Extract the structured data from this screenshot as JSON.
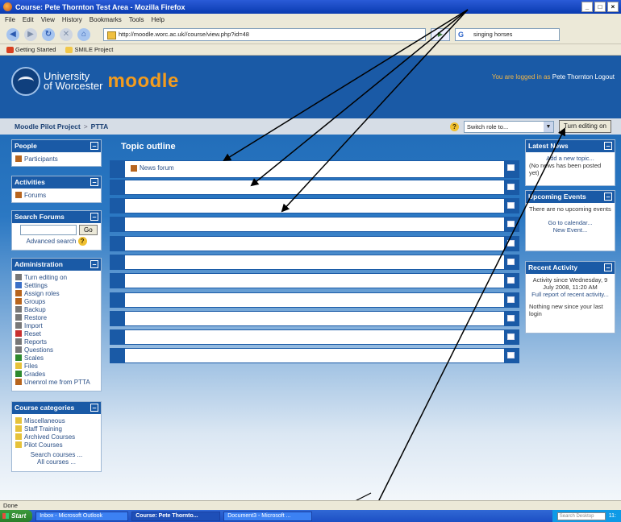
{
  "window": {
    "title": "Course: Pete Thornton Test Area - Mozilla Firefox",
    "controls": [
      "_",
      "□",
      "×"
    ]
  },
  "menubar": [
    "File",
    "Edit",
    "View",
    "History",
    "Bookmarks",
    "Tools",
    "Help"
  ],
  "navbar": {
    "url": "http://moodle.worc.ac.uk//course/view.php?id=48",
    "search_value": "singing horses"
  },
  "bookmarks": [
    "Getting Started",
    "SMILE Project"
  ],
  "header": {
    "logo_line1": "University",
    "logo_line2": "of Worcester",
    "brand": "moodle",
    "logged_in_prefix": "You are logged in as",
    "user_name": "Pete Thornton",
    "logout": "Logout"
  },
  "breadcrumb": {
    "root": "Moodle Pilot Project",
    "separator": ">",
    "current": "PTTA"
  },
  "role_switch": {
    "selected": "Switch role to...",
    "edit_button": "Turn editing on"
  },
  "blocks_left": {
    "people": {
      "title": "People",
      "items": [
        "Participants"
      ]
    },
    "activities": {
      "title": "Activities",
      "items": [
        "Forums"
      ]
    },
    "search_forums": {
      "title": "Search Forums",
      "go": "Go",
      "advanced": "Advanced search"
    },
    "administration": {
      "title": "Administration",
      "items": [
        "Turn editing on",
        "Settings",
        "Assign roles",
        "Groups",
        "Backup",
        "Restore",
        "Import",
        "Reset",
        "Reports",
        "Questions",
        "Scales",
        "Files",
        "Grades",
        "Unenrol me from PTTA"
      ]
    },
    "course_categories": {
      "title": "Course categories",
      "items": [
        "Miscellaneous",
        "Staff Training",
        "Archived Courses",
        "Pilot Courses"
      ],
      "search": "Search courses ...",
      "all": "All courses ..."
    }
  },
  "topic_outline": {
    "title": "Topic outline",
    "forum": "News forum"
  },
  "blocks_right": {
    "latest_news": {
      "title": "Latest News",
      "add": "Add a new topic...",
      "empty": "(No news has been posted yet)"
    },
    "upcoming_events": {
      "title": "Upcoming Events",
      "empty": "There are no upcoming events",
      "calendar": "Go to calendar...",
      "new_event": "New Event..."
    },
    "recent_activity": {
      "title": "Recent Activity",
      "since": "Activity since Wednesday, 9 July 2008, 11:20 AM",
      "full_report": "Full report of recent activity...",
      "nothing": "Nothing new since your last login"
    }
  },
  "statusbar": "Done",
  "taskbar": {
    "start": "Start",
    "items": [
      "Inbox - Microsoft Outlook",
      "Course: Pete Thornto...",
      "Document3 - Microsoft ..."
    ],
    "desktop_search": "Search Desktop",
    "clock": "11:"
  }
}
